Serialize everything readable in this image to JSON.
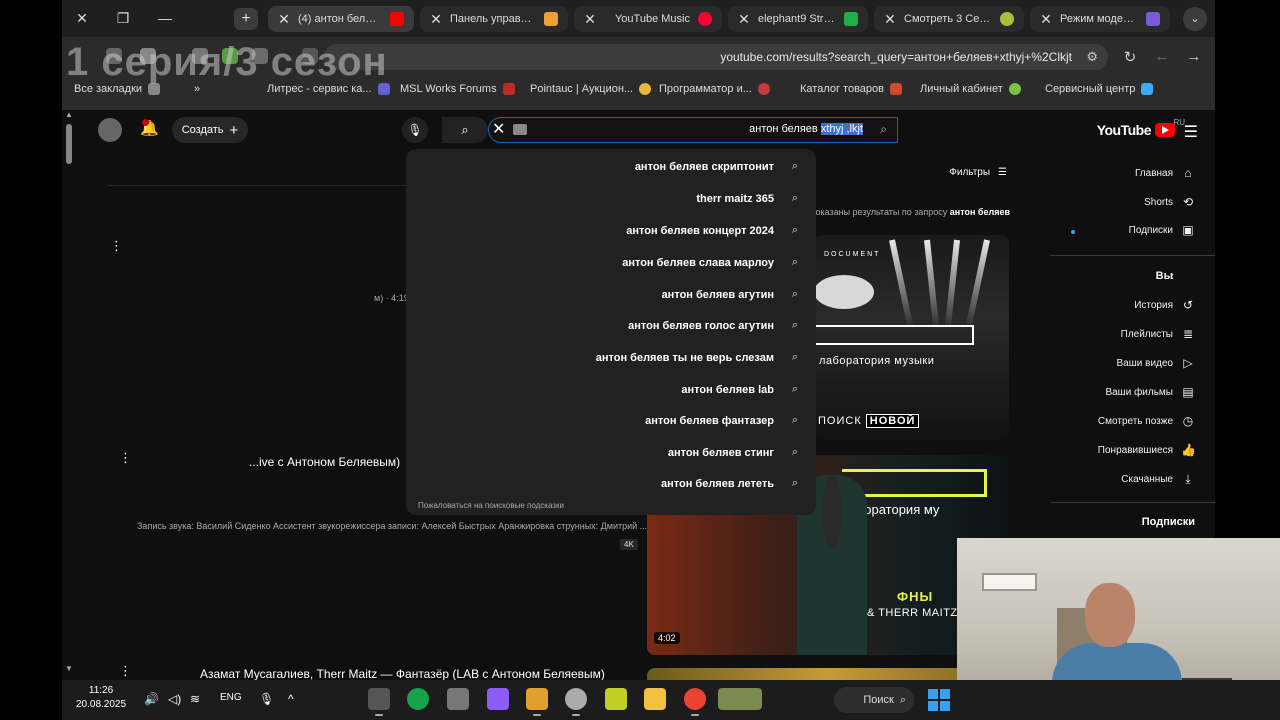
{
  "watermark": "1 серия/3 сезон",
  "browser": {
    "tabs": [
      {
        "title": "Режим модерато",
        "color": "#7b5cd6"
      },
      {
        "title": "Смотреть 3 Сезон",
        "color": "#a7c23a"
      },
      {
        "title": "elephant9 Stream",
        "color": "#1fae4b"
      },
      {
        "title": "YouTube Music",
        "color": "#ff0033"
      },
      {
        "title": "Панель управлен",
        "color": "#f0a030"
      },
      {
        "title": "(4) антон беляев",
        "color": "#ff0000"
      }
    ],
    "url": "youtube.com/results?search_query=антон+беляев+xthyj+%2Clkjt",
    "bookmarks": [
      {
        "label": "Сервисный центр",
        "color": "#3fa9f5"
      },
      {
        "label": "Личный кабинет",
        "color": "#7cc242"
      },
      {
        "label": "Каталог товаров",
        "color": "#d04a2a"
      },
      {
        "label": "Программатор и...",
        "color": "#c23a3a"
      },
      {
        "label": "Pointauc | Аукцион...",
        "color": "#e8b83a"
      },
      {
        "label": "MSL Works Forums",
        "color": "#c22a2a"
      },
      {
        "label": "Литрес - сервис ка...",
        "color": "#6060d0"
      },
      {
        "label": "Все закладки",
        "color": "#888888"
      }
    ]
  },
  "youtube": {
    "wordmark": "YouTube",
    "region": "RU",
    "search": {
      "query_prefix": "антон беляев ",
      "query_selected": "xthyj ,lkjt"
    },
    "create_label": "Создать",
    "filters_label": "Фильтры",
    "results_note_prefix": "Показаны результаты по запросу ",
    "results_note_query": "антон беляев",
    "sidebar": {
      "main": [
        "Главная",
        "Shorts",
        "Подписки"
      ],
      "you_header": "Вы",
      "you": [
        "История",
        "Плейлисты",
        "Ваши видео",
        "Ваши фильмы",
        "Смотреть позже",
        "Понравившиеся",
        "Скачанные"
      ],
      "subscriptions_header": "Подписки"
    },
    "suggestions": [
      "антон беляев скриптонит",
      "therr maitz 365",
      "антон беляев концерт 2024",
      "антон беляев слава марлоу",
      "антон беляев агутин",
      "антон беляев голос агутин",
      "антон беляев ты не верь слезам",
      "антон беляев lab",
      "антон беляев фантазер",
      "антон беляев стинг",
      "антон беляев лететь"
    ],
    "report_link": "Пожаловаться на поисковые подсказки",
    "videos": {
      "title1_suffix": "...ive с Антоном Беляевым)",
      "meta1": "м) · 4:19",
      "desc2": "Запись звука: Василий Сиденко Ассистент звукорежиссера записи: Алексей Быстрых Аранжировка струнных: Дмитрий ...",
      "badge": "4K",
      "duration2": "4:02",
      "title3": "Азамат Мусагалиев, Therr Maitz — Фантазёр (LAB с Антоном Беляевым)",
      "thumb1_lab": "лаборатория музыки",
      "thumb1_doc": "DOCUMENT",
      "thumb1_new": "НОВОЙ",
      "thumb1_search": "ПОИСК",
      "thumb2_lab": "лаборатория му",
      "thumb2_line1": "ФНЫ",
      "thumb2_line2": "& THERR MAITZ"
    }
  },
  "taskbar": {
    "time": "11:26",
    "date": "20.08.2025",
    "lang": "ENG",
    "search_label": "Поиск",
    "apps": [
      {
        "name": "files-app",
        "color": "#555"
      },
      {
        "name": "green-app",
        "color": "#16a34a"
      },
      {
        "name": "gpu-app",
        "color": "#777"
      },
      {
        "name": "paint-app",
        "color": "#8b5cf6"
      },
      {
        "name": "apps-grid",
        "color": "#e0a030"
      },
      {
        "name": "tools-app",
        "color": "#aaa"
      },
      {
        "name": "chip-app",
        "color": "#c0d020"
      },
      {
        "name": "explorer-app",
        "color": "#f0c040"
      },
      {
        "name": "chrome-app",
        "color": "#ea4335"
      },
      {
        "name": "game-app",
        "color": "#7a8a50"
      }
    ]
  }
}
